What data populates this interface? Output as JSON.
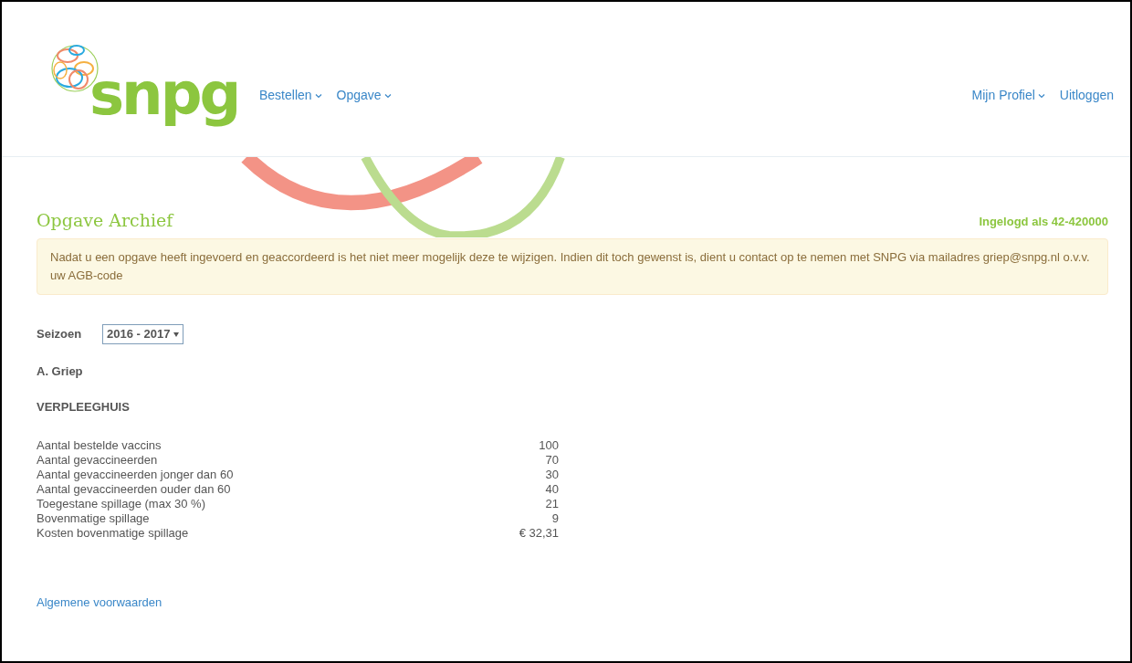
{
  "header": {
    "logo_text": "snpg",
    "nav": [
      {
        "label": "Bestellen",
        "dropdown": true
      },
      {
        "label": "Opgave",
        "dropdown": true
      }
    ],
    "nav_right": [
      {
        "label": "Mijn Profiel",
        "dropdown": true
      },
      {
        "label": "Uitloggen",
        "dropdown": false
      }
    ]
  },
  "page": {
    "title": "Opgave Archief",
    "logged_in": "Ingelogd als 42-420000"
  },
  "alert": "Nadat u een opgave heeft ingevoerd en geaccordeerd is het niet meer mogelijk deze te wijzigen. Indien dit toch gewenst is, dient u contact op te nemen met SNPG via mailadres griep@snpg.nl o.v.v. uw AGB-code",
  "season": {
    "label": "Seizoen",
    "value": "2016 - 2017"
  },
  "section": "A. Griep",
  "subsection": "VERPLEEGHUIS",
  "rows": [
    {
      "label": "Aantal bestelde vaccins",
      "value": "100"
    },
    {
      "label": "Aantal gevaccineerden",
      "value": "70"
    },
    {
      "label": "Aantal gevaccineerden jonger dan 60",
      "value": "30"
    },
    {
      "label": "Aantal gevaccineerden ouder dan 60",
      "value": "40"
    },
    {
      "label": "Toegestane spillage (max 30 %)",
      "value": "21"
    },
    {
      "label": "Bovenmatige spillage",
      "value": "9"
    },
    {
      "label": "Kosten bovenmatige spillage",
      "value": "€ 32,31"
    }
  ],
  "footer_link": "Algemene voorwaarden"
}
